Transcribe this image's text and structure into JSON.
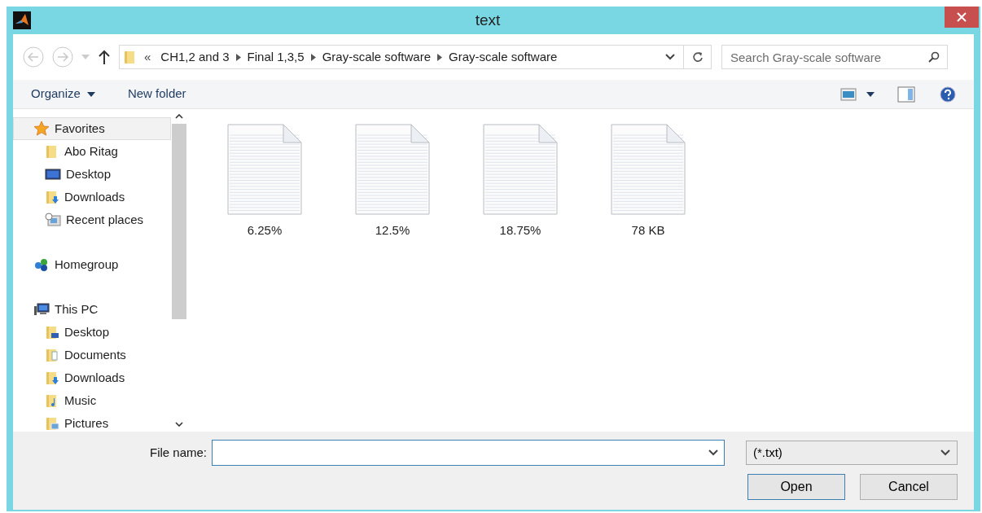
{
  "window": {
    "title": "text"
  },
  "breadcrumb": {
    "overflow": "«",
    "segments": [
      "CH1,2 and 3",
      "Final 1,3,5",
      "Gray-scale software",
      "Gray-scale software"
    ]
  },
  "search": {
    "placeholder": "Search Gray-scale software"
  },
  "toolbar": {
    "organize": "Organize",
    "new_folder": "New folder"
  },
  "sidebar": {
    "groups": [
      {
        "label": "Favorites",
        "kind": "star",
        "selected": true,
        "children": [
          {
            "label": "Abo Ritag",
            "kind": "folder",
            "selected": false
          },
          {
            "label": "Desktop",
            "kind": "desktop",
            "selected": false
          },
          {
            "label": "Downloads",
            "kind": "downloads",
            "selected": false
          },
          {
            "label": "Recent places",
            "kind": "recent",
            "selected": false
          }
        ]
      },
      {
        "label": "Homegroup",
        "kind": "homegroup",
        "selected": false
      },
      {
        "label": "This PC",
        "kind": "pc",
        "selected": false,
        "children": [
          {
            "label": "Desktop",
            "kind": "pcdesktop",
            "selected": false
          },
          {
            "label": "Documents",
            "kind": "documents",
            "selected": false
          },
          {
            "label": "Downloads",
            "kind": "downloads",
            "selected": false
          },
          {
            "label": "Music",
            "kind": "music",
            "selected": false
          },
          {
            "label": "Pictures",
            "kind": "pictures",
            "selected": false
          }
        ]
      }
    ]
  },
  "files": [
    {
      "name": "6.25%"
    },
    {
      "name": "12.5%"
    },
    {
      "name": "18.75%"
    },
    {
      "name": "78 KB"
    }
  ],
  "footer": {
    "file_name_label": "File name:",
    "filter": "(*.txt)",
    "buttons": [
      {
        "label": "Open",
        "default": true
      },
      {
        "label": "Cancel",
        "default": false
      }
    ]
  }
}
